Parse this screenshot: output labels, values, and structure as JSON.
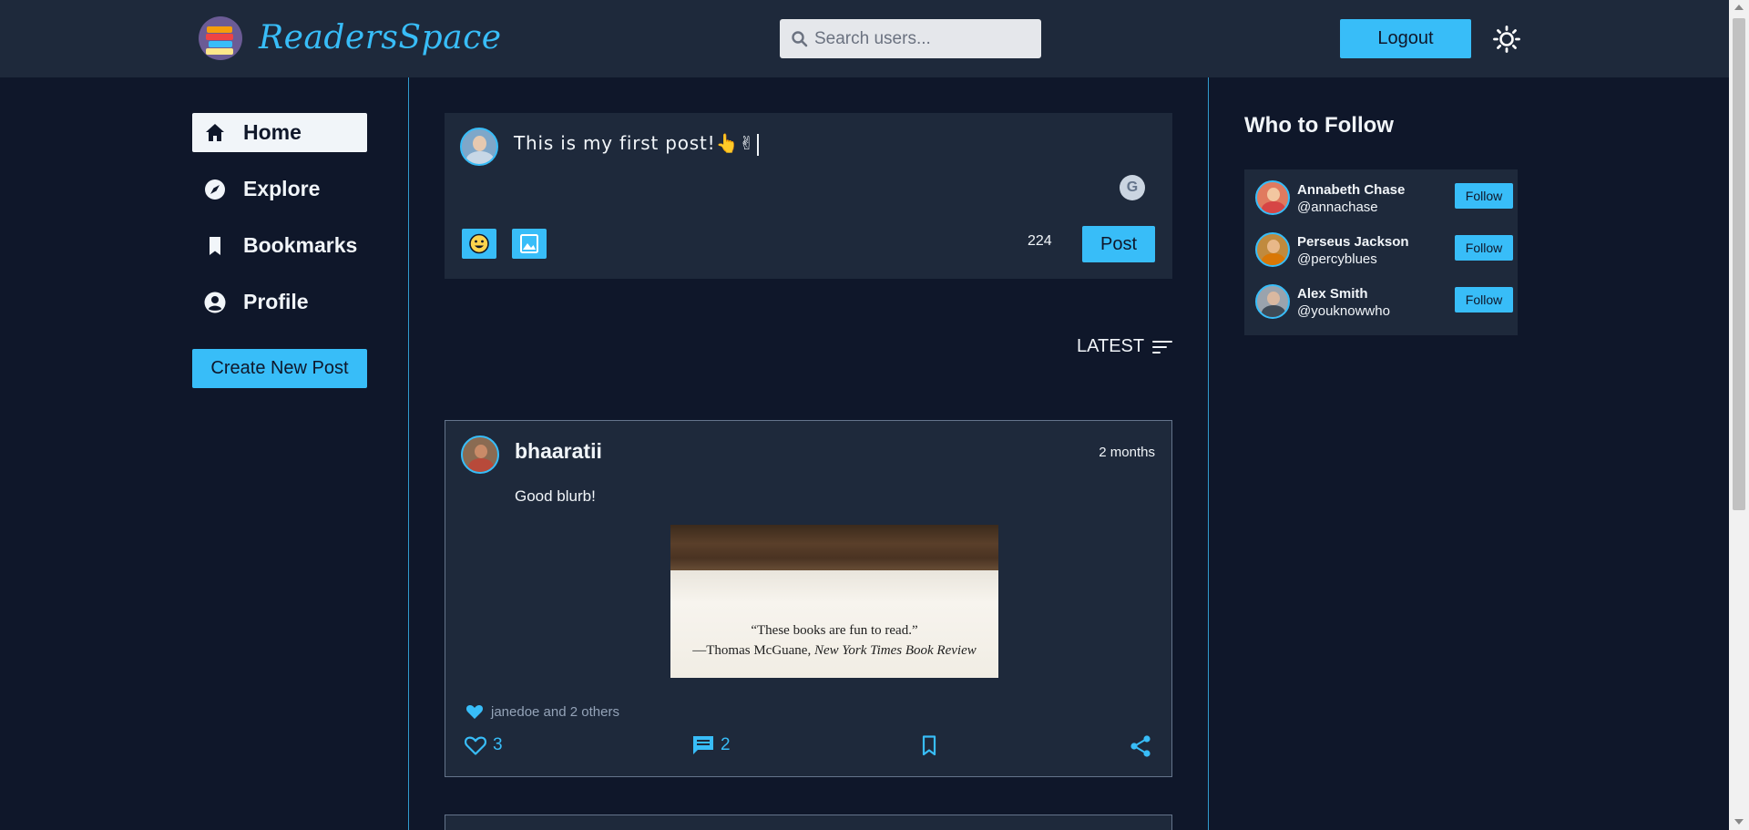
{
  "header": {
    "brand": "ReadersSpace",
    "search_placeholder": "Search users...",
    "logout_label": "Logout",
    "theme_icon": "sun-icon"
  },
  "nav": {
    "items": [
      {
        "label": "Home",
        "icon": "home-icon",
        "active": true
      },
      {
        "label": "Explore",
        "icon": "compass-icon",
        "active": false
      },
      {
        "label": "Bookmarks",
        "icon": "bookmark-icon",
        "active": false
      },
      {
        "label": "Profile",
        "icon": "user-circle-icon",
        "active": false
      }
    ],
    "create_post_label": "Create New Post"
  },
  "composer": {
    "text": "This is my first post!👆✌",
    "char_count": "224",
    "post_label": "Post",
    "grammarly_label": "G"
  },
  "feed": {
    "sort_label": "LATEST",
    "posts": [
      {
        "username": "bhaaratii",
        "time": "2 months",
        "content": "Good blurb!",
        "image_quote": "“These books are fun to read.”",
        "image_attribution_prefix": "—Thomas McGuane, ",
        "image_attribution_source": "New York Times Book Review",
        "liked_by": "janedoe and 2 others",
        "likes": "3",
        "comments": "2"
      }
    ]
  },
  "who_to_follow": {
    "title": "Who to Follow",
    "follow_label": "Follow",
    "users": [
      {
        "name": "Annabeth Chase",
        "handle": "@annachase"
      },
      {
        "name": "Perseus Jackson",
        "handle": "@percyblues"
      },
      {
        "name": "Alex Smith",
        "handle": "@youknowwho"
      }
    ]
  },
  "colors": {
    "accent": "#38bdf8",
    "background": "#0f172a",
    "surface": "#1e293b"
  }
}
